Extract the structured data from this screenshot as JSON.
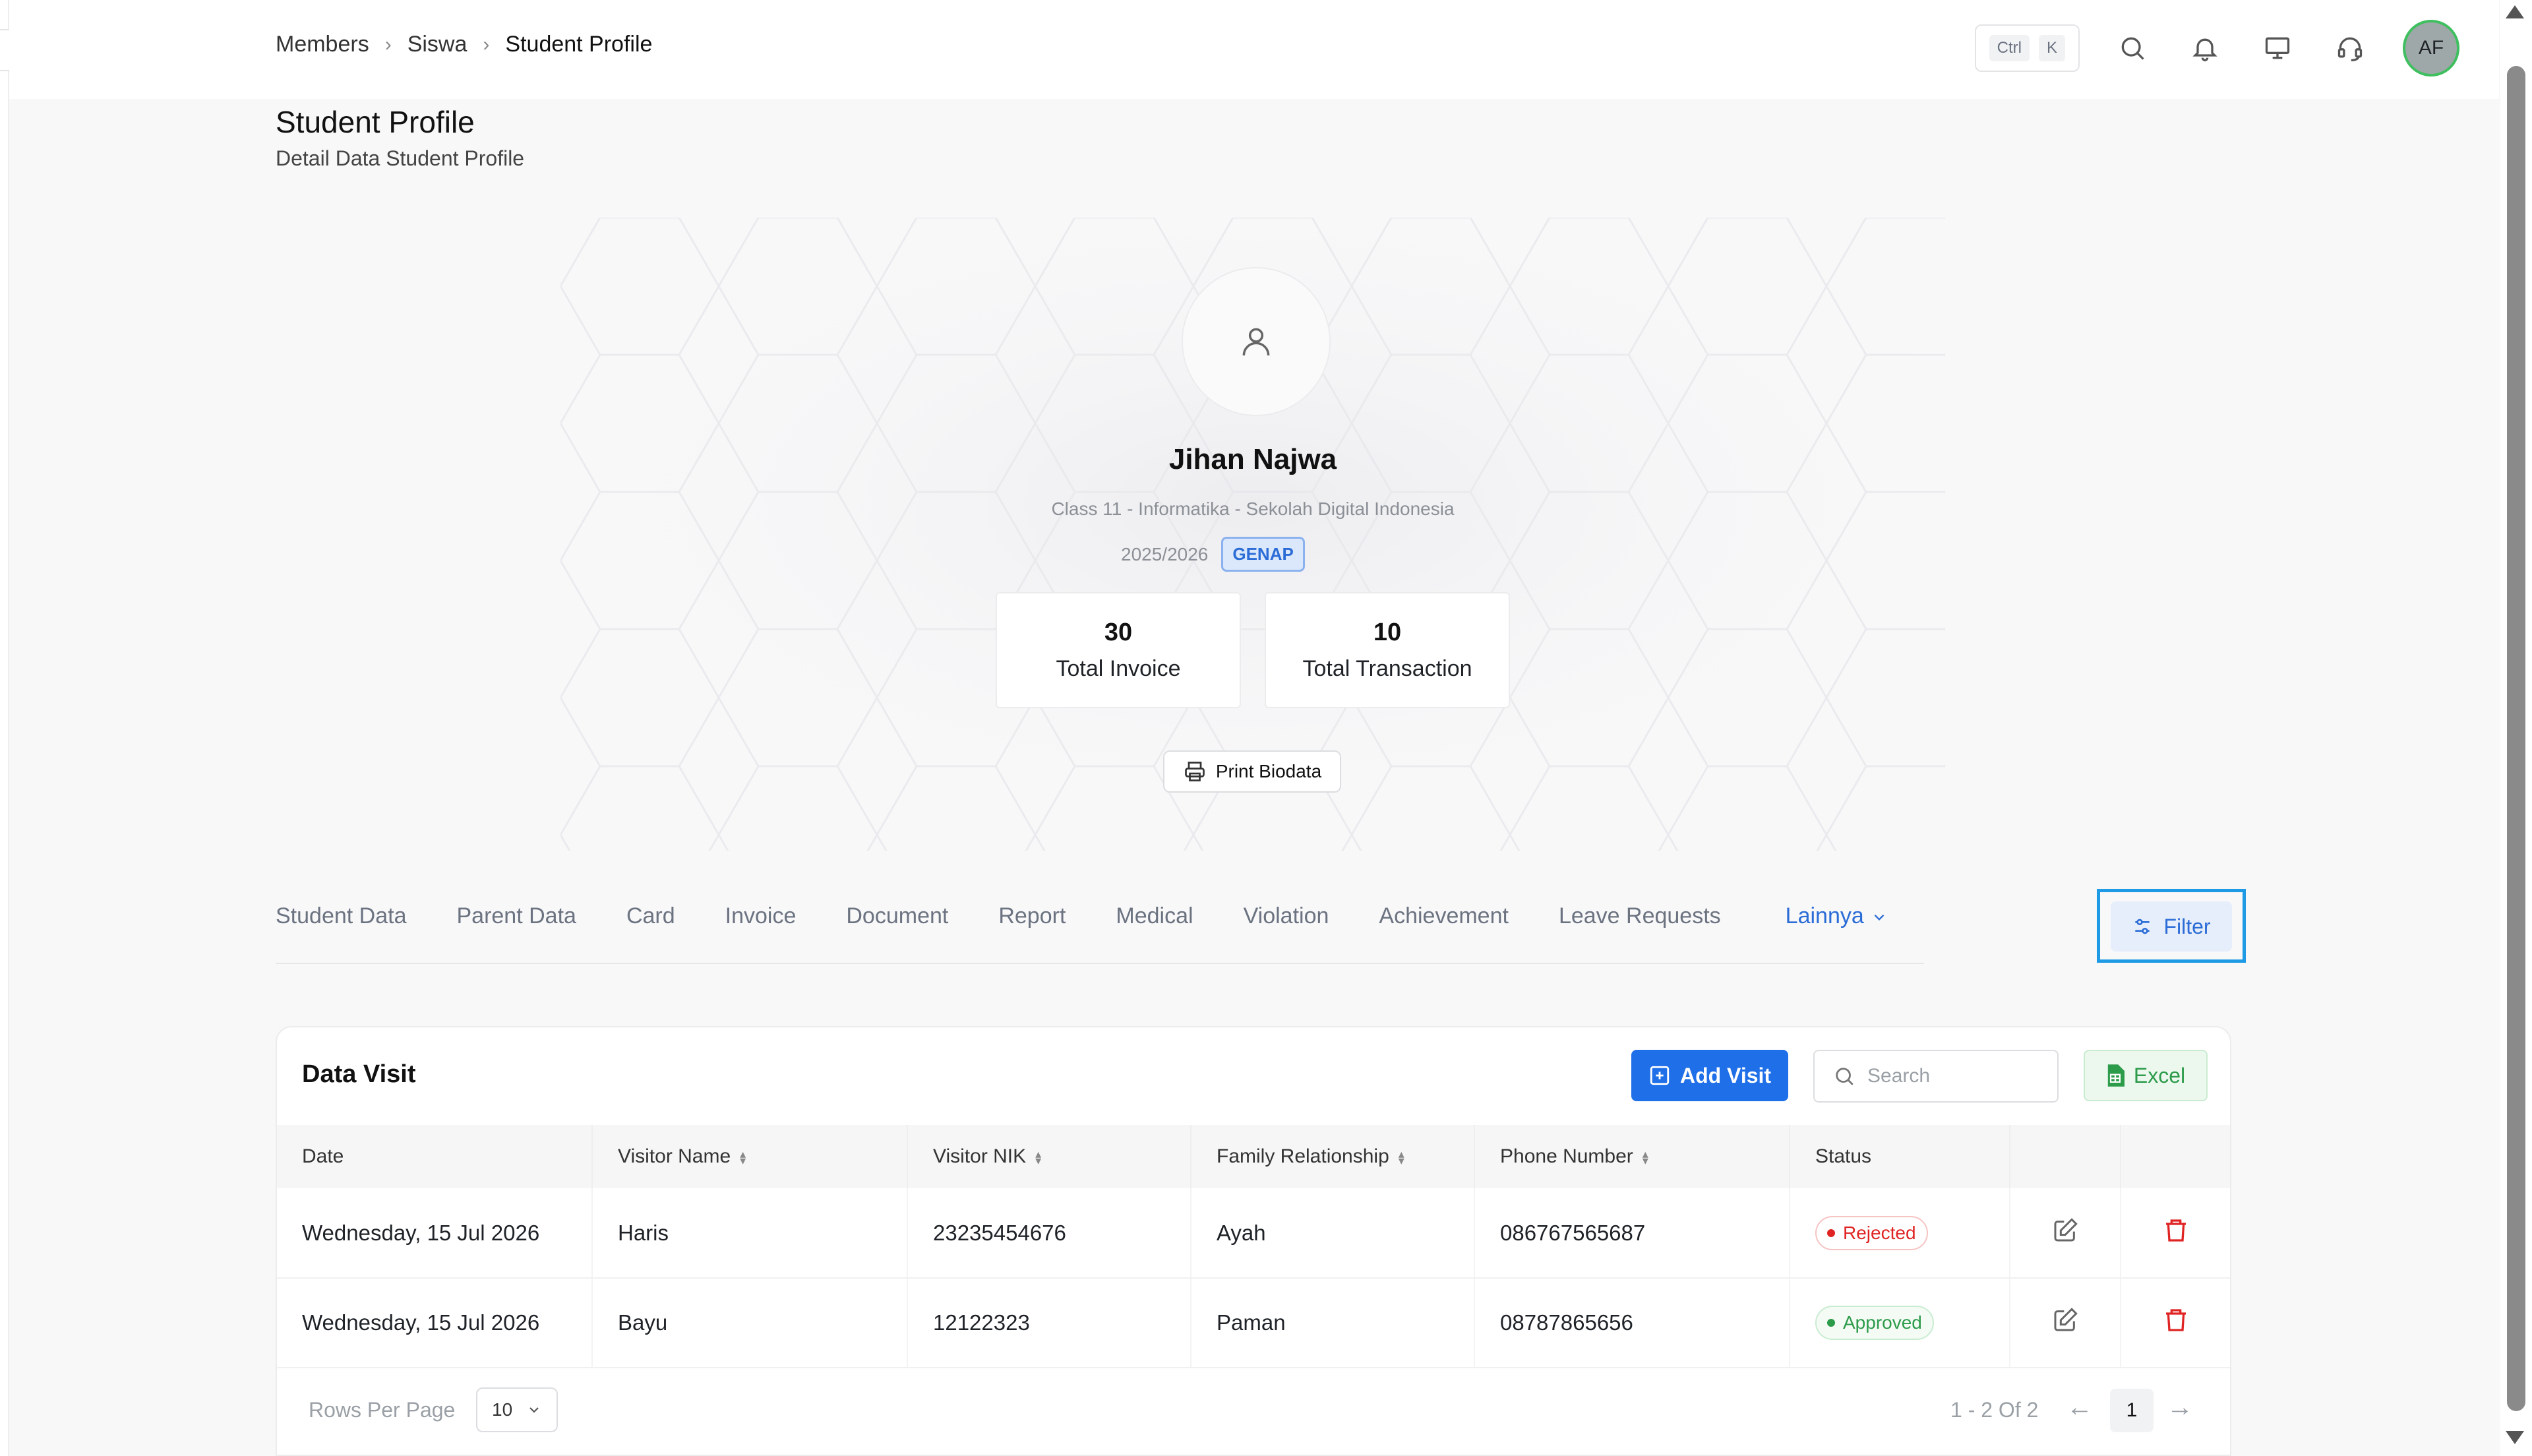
{
  "breadcrumb": [
    "Members",
    "Siswa",
    "Student Profile"
  ],
  "shortcut": {
    "key1": "Ctrl",
    "key2": "K"
  },
  "user": {
    "initials": "AF"
  },
  "page": {
    "title": "Student Profile",
    "subtitle": "Detail Data Student Profile"
  },
  "profile": {
    "name": "Jihan Najwa",
    "meta": "Class 11 - Informatika - Sekolah Digital Indonesia",
    "year": "2025/2026",
    "semester": "GENAP",
    "stats": [
      {
        "value": "30",
        "label": "Total Invoice"
      },
      {
        "value": "10",
        "label": "Total Transaction"
      }
    ],
    "print_label": "Print Biodata"
  },
  "tabs": [
    "Student Data",
    "Parent Data",
    "Card",
    "Invoice",
    "Document",
    "Report",
    "Medical",
    "Violation",
    "Achievement",
    "Leave Requests"
  ],
  "more_tab": "Lainnya",
  "filter_label": "Filter",
  "data_card": {
    "title": "Data Visit",
    "add_label": "Add Visit",
    "search_placeholder": "Search",
    "excel_label": "Excel"
  },
  "table": {
    "headers": [
      "Date",
      "Visitor Name",
      "Visitor NIK",
      "Family Relationship",
      "Phone Number",
      "Status"
    ],
    "rows": [
      {
        "date": "Wednesday, 15 Jul 2026",
        "name": "Haris",
        "nik": "23235454676",
        "relation": "Ayah",
        "phone": "086767565687",
        "status": "Rejected"
      },
      {
        "date": "Wednesday, 15 Jul 2026",
        "name": "Bayu",
        "nik": "12122323",
        "relation": "Paman",
        "phone": "08787865656",
        "status": "Approved"
      }
    ]
  },
  "pagination": {
    "rows_label": "Rows Per Page",
    "rows_value": "10",
    "info": "1 - 2 Of 2",
    "page": "1"
  },
  "colors": {
    "primary": "#1f6fe8",
    "success": "#2c9b4a",
    "danger": "#e02424",
    "highlight": "#1f9be6"
  }
}
